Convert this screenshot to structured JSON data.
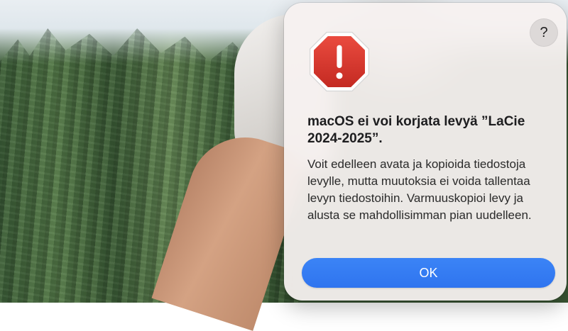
{
  "dialog": {
    "title": "macOS ei voi korjata levyä ”LaCie 2024-2025”.",
    "message": "Voit edelleen avata ja kopioida tiedostoja levylle, mutta muutoksia ei voida tallentaa levyn tiedostoihin. Varmuuskopioi levy ja alusta se mahdollisimman pian uudelleen.",
    "help_label": "?",
    "ok_label": "OK",
    "icon": "stop-icon",
    "accent_color": "#3b84f6",
    "alert_color": "#d9342b"
  }
}
